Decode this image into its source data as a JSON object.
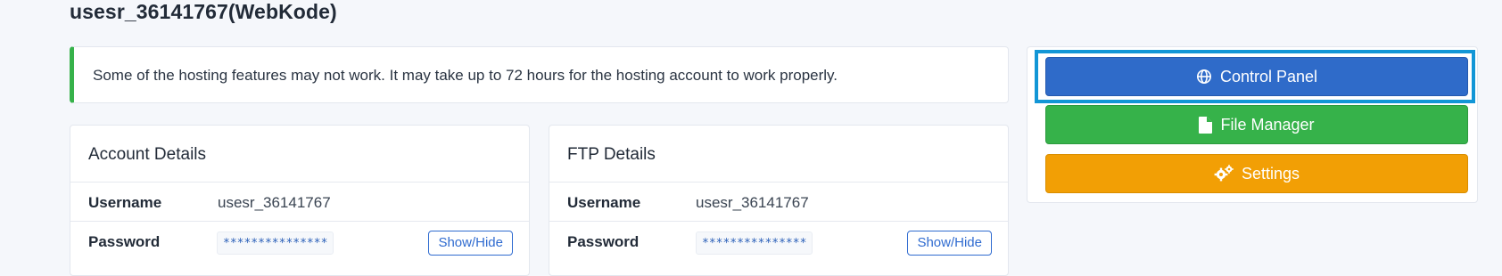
{
  "page": {
    "title": "usesr_36141767(WebKode)"
  },
  "alert": {
    "text": "Some of the hosting features may not work. It may take up to 72 hours for the hosting account to work properly."
  },
  "account_details": {
    "title": "Account Details",
    "username_label": "Username",
    "username_value": "usesr_36141767",
    "password_label": "Password",
    "password_value": "***************",
    "show_hide_label": "Show/Hide"
  },
  "ftp_details": {
    "title": "FTP Details",
    "username_label": "Username",
    "username_value": "usesr_36141767",
    "password_label": "Password",
    "password_value": "***************",
    "show_hide_label": "Show/Hide"
  },
  "side_actions": {
    "control_panel": {
      "label": "Control Panel",
      "icon": "globe-icon",
      "color": "#2f6bc9"
    },
    "file_manager": {
      "label": "File Manager",
      "icon": "file-icon",
      "color": "#36b24a"
    },
    "settings": {
      "label": "Settings",
      "icon": "gears-icon",
      "color": "#f29f05"
    }
  },
  "colors": {
    "focus_ring": "#1296d6",
    "alert_accent": "#36b24a",
    "outline_button": "#2f6bd0"
  }
}
